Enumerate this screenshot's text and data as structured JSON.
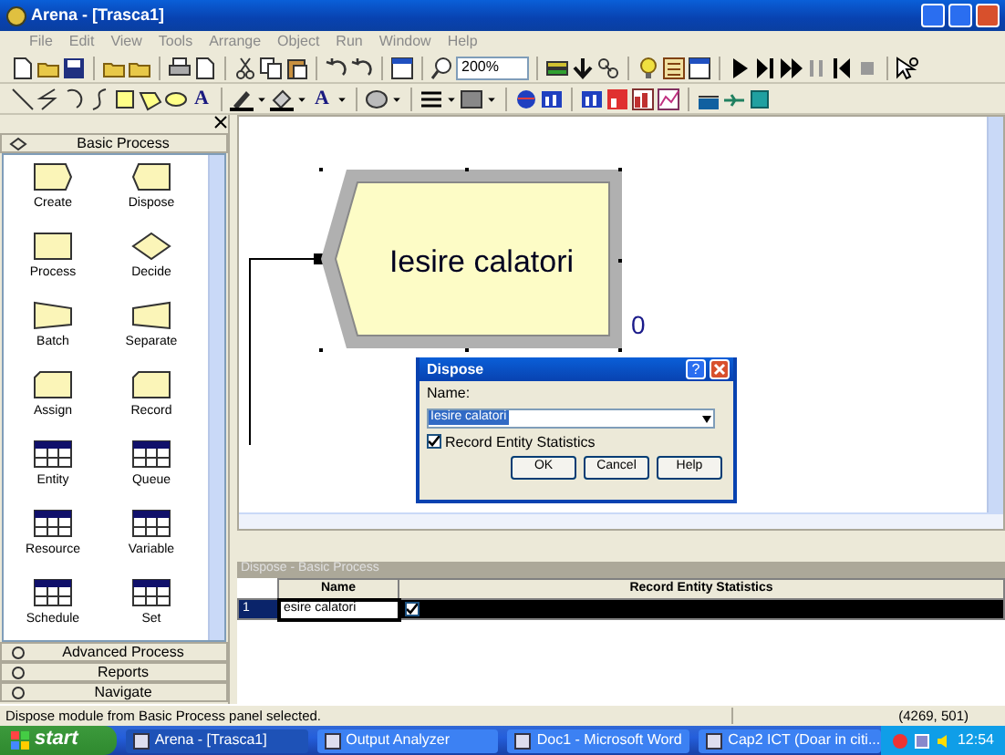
{
  "window": {
    "title": "Arena - [Trasca1]"
  },
  "menu": [
    "File",
    "Edit",
    "View",
    "Tools",
    "Arrange",
    "Object",
    "Run",
    "Window",
    "Help"
  ],
  "toolbar": {
    "zoom_value": "200%"
  },
  "draw_toolbar": {
    "text_tool": "A",
    "text_color_tool": "A"
  },
  "project_bar": {
    "panels": [
      {
        "title": "Basic Process",
        "expanded": true
      },
      {
        "title": "Advanced Process",
        "expanded": false
      },
      {
        "title": "Reports",
        "expanded": false
      },
      {
        "title": "Navigate",
        "expanded": false
      }
    ],
    "modules": [
      {
        "label": "Create",
        "kind": "create"
      },
      {
        "label": "Dispose",
        "kind": "dispose"
      },
      {
        "label": "Process",
        "kind": "process"
      },
      {
        "label": "Decide",
        "kind": "decide"
      },
      {
        "label": "Batch",
        "kind": "batch"
      },
      {
        "label": "Separate",
        "kind": "separate"
      },
      {
        "label": "Assign",
        "kind": "assign"
      },
      {
        "label": "Record",
        "kind": "record"
      },
      {
        "label": "Entity",
        "kind": "data"
      },
      {
        "label": "Queue",
        "kind": "data"
      },
      {
        "label": "Resource",
        "kind": "data"
      },
      {
        "label": "Variable",
        "kind": "data"
      },
      {
        "label": "Schedule",
        "kind": "data"
      },
      {
        "label": "Set",
        "kind": "data"
      }
    ]
  },
  "canvas": {
    "module": {
      "label": "Iesire calatori",
      "counter": "0",
      "selected": true
    }
  },
  "dialog": {
    "title": "Dispose",
    "help_glyph": "?",
    "name_label": "Name:",
    "name_value": "Iesire calatori",
    "checkbox": {
      "label": "Record Entity Statistics",
      "checked": true
    },
    "buttons": [
      "OK",
      "Cancel",
      "Help"
    ]
  },
  "spreadsheet": {
    "title": "Dispose - Basic Process",
    "columns": [
      "Name",
      "Record Entity Statistics"
    ],
    "rows": [
      {
        "index": "1",
        "name": "esire calatori",
        "record_entity_statistics": true,
        "selected": true
      }
    ]
  },
  "status_bar": {
    "message": "Dispose module from Basic Process panel selected.",
    "coordinates": "(4269, 501)"
  },
  "taskbar": {
    "start": "start",
    "tasks": [
      {
        "label": "Arena - [Trasca1]",
        "active": true
      },
      {
        "label": "Output Analyzer",
        "active": false
      },
      {
        "label": "Doc1 - Microsoft Word",
        "active": false
      },
      {
        "label": "Cap2 ICT (Doar in citi...",
        "active": false
      }
    ],
    "clock": "12:54"
  }
}
